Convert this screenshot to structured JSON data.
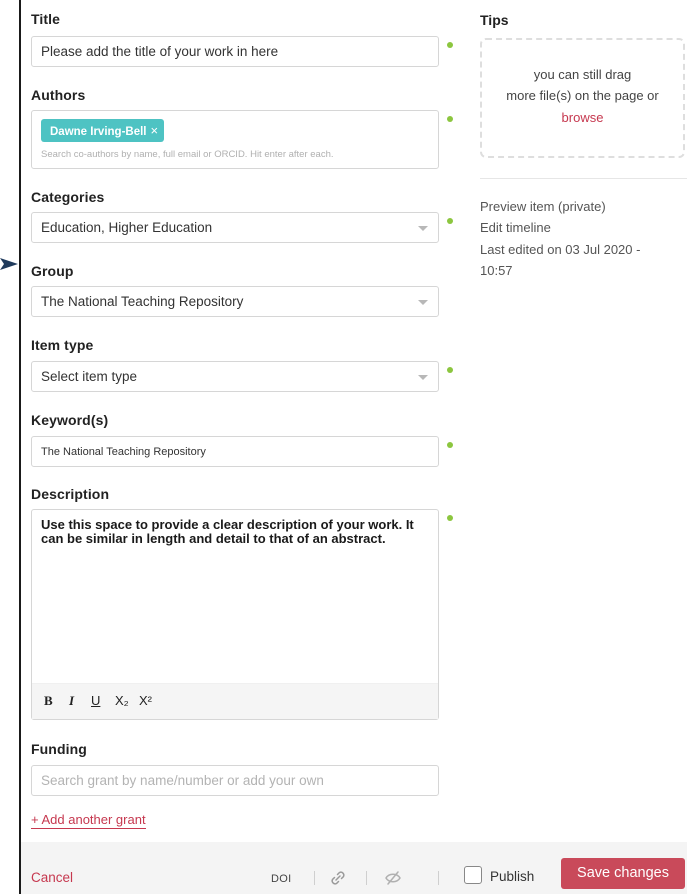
{
  "form": {
    "title": {
      "label": "Title",
      "placeholder": "Please add the title of your work in here"
    },
    "authors": {
      "label": "Authors",
      "tag": "Dawne Irving-Bell",
      "tag_remove": "×",
      "hint": "Search co-authors by name, full email or ORCID. Hit enter after each."
    },
    "categories": {
      "label": "Categories",
      "value": "Education, Higher Education"
    },
    "group": {
      "label": "Group",
      "value": "The National Teaching Repository"
    },
    "item_type": {
      "label": "Item type",
      "value": "Select item type"
    },
    "keywords": {
      "label": "Keyword(s)",
      "value": "The National Teaching Repository"
    },
    "description": {
      "label": "Description",
      "text": "Use this space to provide a clear description of your work. It can be similar in length and detail to that of an abstract.",
      "toolbar": {
        "bold": "B",
        "italic": "I",
        "underline": "U",
        "subscript": "X₂",
        "superscript": "X²"
      }
    },
    "funding": {
      "label": "Funding",
      "placeholder": "Search grant by name/number or add your own",
      "add_link": "+ Add another grant"
    }
  },
  "sidebar": {
    "tips_title": "Tips",
    "dropzone": {
      "line1": "you can still drag",
      "line2": "more file(s) on the page or",
      "browse": "browse"
    },
    "preview_link": "Preview item (private)",
    "timeline_link": "Edit timeline",
    "last_edited_line1": "Last edited on 03 Jul 2020 -",
    "last_edited_line2": "10:57"
  },
  "footer": {
    "cancel": "Cancel",
    "doi": "DOI",
    "publish": "Publish",
    "save": "Save changes"
  },
  "colors": {
    "accent_red": "#c6384f",
    "save_button": "#c94a5a",
    "tag_teal": "#4ec3c3",
    "required_dot": "#8cc63f"
  },
  "icons": [
    "pointer-arrow-icon",
    "dropdown-caret-icon",
    "link-icon",
    "hide-icon"
  ]
}
